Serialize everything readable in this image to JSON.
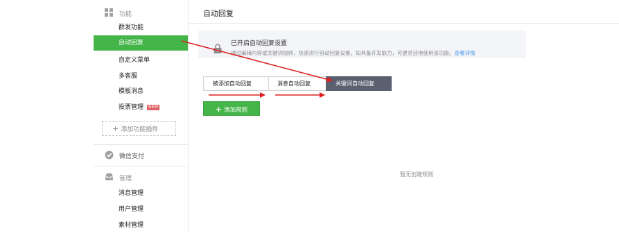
{
  "sidebar": {
    "features": {
      "label": "功能",
      "icon": "grid-icon",
      "items": [
        {
          "label": "群发功能"
        },
        {
          "label": "自动回复"
        },
        {
          "label": "自定义菜单"
        },
        {
          "label": "多客服"
        },
        {
          "label": "模板消息"
        },
        {
          "label": "投票管理",
          "badge": "NEW"
        }
      ],
      "active_item": "自动回复",
      "add_plugin": "添加功能插件"
    },
    "payment": {
      "label": "微信支付",
      "icon": "wechat-pay-icon"
    },
    "manage": {
      "label": "管理",
      "icon": "inbox-icon",
      "items": [
        {
          "label": "消息管理"
        },
        {
          "label": "用户管理"
        },
        {
          "label": "素材管理"
        }
      ]
    }
  },
  "main": {
    "title": "自动回复",
    "notice": {
      "icon": "lock-icon",
      "title": "已开启自动回复设置",
      "desc": "通过编辑内容或关键词规则，快速进行自动回复设置。如具备开发能力，可更灵活地使用该功能。",
      "link": "查看详情"
    },
    "tabs": [
      {
        "label": "被添加自动回复"
      },
      {
        "label": "消息自动回复"
      },
      {
        "label": "关键词自动回复"
      }
    ],
    "active_tab": "关键词自动回复",
    "add_rule": "添加规则",
    "empty_text": "暂无创建规则"
  },
  "colors": {
    "accent_green": "#44b549",
    "active_tab": "#5a6070",
    "annotation_red": "#e02020",
    "link_blue": "#459ae9"
  }
}
